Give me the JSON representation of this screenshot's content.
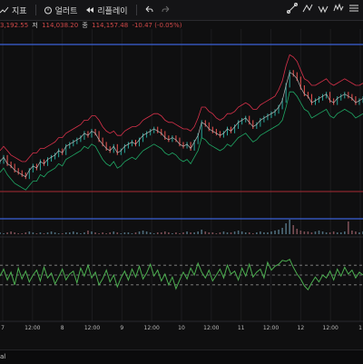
{
  "toolbar": {
    "indicator_label": "지표",
    "alert_label": "얼러트",
    "replay_label": "리플레이",
    "undo_icon": "undo-icon",
    "redo_icon": "redo-icon"
  },
  "ohlc": {
    "open": "3,192.55",
    "low_label": "저",
    "low": "114,038.20",
    "close_label": "종",
    "close": "114,157.48",
    "change": "-10.47 (-0.05%)"
  },
  "colors": {
    "up": "#26a69a",
    "down": "#ef5350",
    "price_line": "#b7b7b7",
    "upper_band": "#d8314a",
    "lower_band": "#1fa865",
    "hline_blue": "#3a62d8",
    "hline_red": "#a82b33",
    "oscillator": "#4caf50"
  },
  "footer": {
    "text": "al"
  },
  "chart_data": {
    "type": "line",
    "x_ticks": [
      "7",
      "12:00",
      "8",
      "12:00",
      "9",
      "12:00",
      "10",
      "12:00",
      "11",
      "12:00",
      "12",
      "12:00",
      "1"
    ],
    "price": [
      30,
      34,
      28,
      26,
      22,
      20,
      18,
      16,
      22,
      26,
      24,
      30,
      28,
      32,
      34,
      36,
      40,
      38,
      44,
      46,
      48,
      50,
      52,
      56,
      54,
      58,
      56,
      50,
      46,
      42,
      40,
      44,
      38,
      40,
      44,
      46,
      48,
      46,
      50,
      54,
      56,
      58,
      60,
      58,
      56,
      52,
      50,
      52,
      50,
      46,
      44,
      46,
      42,
      48,
      54,
      66,
      64,
      60,
      58,
      56,
      54,
      56,
      60,
      58,
      62,
      66,
      68,
      70,
      66,
      62,
      64,
      68,
      70,
      72,
      74,
      76,
      80,
      86,
      100,
      112,
      110,
      106,
      98,
      92,
      90,
      84,
      86,
      88,
      90,
      92,
      86,
      84,
      88,
      90,
      92,
      90,
      88,
      84,
      86,
      88
    ],
    "upper_band": [
      40,
      44,
      40,
      36,
      34,
      32,
      30,
      30,
      34,
      38,
      38,
      42,
      42,
      44,
      46,
      48,
      52,
      52,
      56,
      58,
      60,
      62,
      64,
      68,
      68,
      72,
      72,
      68,
      62,
      58,
      56,
      58,
      54,
      54,
      58,
      60,
      62,
      62,
      64,
      68,
      70,
      72,
      74,
      74,
      72,
      68,
      66,
      66,
      64,
      62,
      60,
      60,
      58,
      62,
      70,
      80,
      80,
      76,
      74,
      70,
      68,
      70,
      74,
      74,
      76,
      80,
      82,
      84,
      82,
      78,
      78,
      82,
      84,
      86,
      88,
      90,
      96,
      104,
      118,
      128,
      126,
      122,
      114,
      106,
      104,
      100,
      100,
      102,
      104,
      106,
      102,
      100,
      102,
      104,
      106,
      104,
      102,
      100,
      100,
      102
    ],
    "lower_band": [
      20,
      24,
      18,
      14,
      10,
      8,
      6,
      4,
      8,
      12,
      12,
      18,
      16,
      20,
      22,
      24,
      28,
      26,
      32,
      34,
      36,
      38,
      40,
      44,
      42,
      46,
      44,
      38,
      32,
      28,
      26,
      30,
      24,
      26,
      30,
      32,
      34,
      32,
      36,
      40,
      42,
      44,
      46,
      44,
      42,
      38,
      36,
      38,
      36,
      32,
      30,
      32,
      28,
      34,
      40,
      52,
      50,
      46,
      44,
      42,
      40,
      42,
      46,
      44,
      48,
      52,
      54,
      56,
      52,
      48,
      50,
      54,
      56,
      58,
      60,
      62,
      64,
      68,
      80,
      94,
      94,
      90,
      84,
      78,
      76,
      70,
      72,
      74,
      76,
      78,
      72,
      70,
      74,
      76,
      78,
      76,
      74,
      70,
      72,
      74
    ],
    "volume": [
      2,
      1,
      2,
      3,
      2,
      1,
      1,
      2,
      3,
      2,
      1,
      2,
      1,
      2,
      3,
      2,
      1,
      1,
      2,
      2,
      3,
      2,
      1,
      2,
      4,
      3,
      2,
      1,
      2,
      1,
      2,
      3,
      2,
      1,
      2,
      2,
      1,
      2,
      3,
      4,
      3,
      2,
      1,
      2,
      2,
      3,
      2,
      1,
      2,
      1,
      2,
      3,
      2,
      2,
      3,
      5,
      3,
      2,
      2,
      1,
      2,
      3,
      2,
      2,
      3,
      4,
      3,
      2,
      2,
      1,
      2,
      3,
      2,
      2,
      3,
      4,
      5,
      7,
      12,
      16,
      10,
      6,
      4,
      3,
      3,
      2,
      3,
      4,
      3,
      2,
      2,
      3,
      2,
      2,
      3,
      14,
      4,
      3,
      2,
      3
    ],
    "oscillator": [
      48,
      62,
      40,
      56,
      30,
      64,
      42,
      58,
      36,
      50,
      60,
      38,
      66,
      44,
      54,
      32,
      46,
      62,
      40,
      52,
      58,
      34,
      64,
      48,
      70,
      44,
      56,
      30,
      42,
      60,
      36,
      50,
      26,
      44,
      58,
      40,
      62,
      46,
      68,
      42,
      54,
      72,
      48,
      60,
      38,
      52,
      30,
      46,
      22,
      40,
      56,
      42,
      64,
      50,
      74,
      56,
      44,
      60,
      38,
      50,
      62,
      44,
      70,
      52,
      58,
      40,
      64,
      48,
      72,
      46,
      56,
      62,
      44,
      76,
      60,
      68,
      72,
      80,
      78,
      82,
      66,
      52,
      42,
      28,
      20,
      34,
      46,
      36,
      50,
      44,
      58,
      40,
      62,
      48,
      66,
      52,
      60,
      44,
      56,
      50
    ],
    "oscillator_levels": [
      70,
      50,
      30
    ],
    "price_ylim": [
      0,
      130
    ],
    "osc_ylim": [
      0,
      100
    ]
  }
}
